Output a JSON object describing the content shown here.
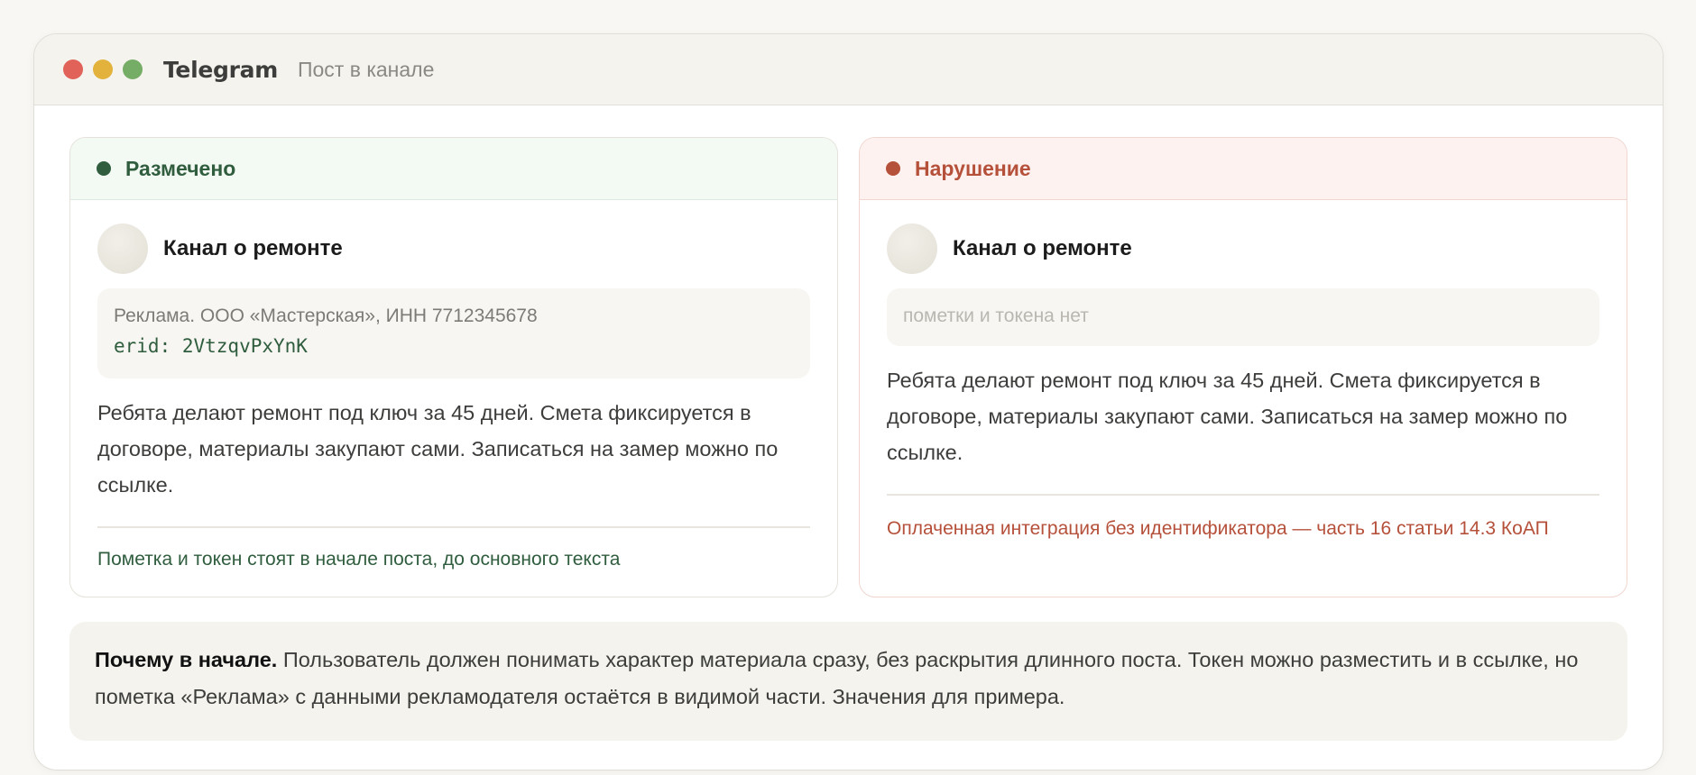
{
  "window": {
    "app_title": "Telegram",
    "subtitle": "Пост в канале"
  },
  "panels": [
    {
      "status": "Размечено",
      "status_color": "#2f5d3e",
      "channel_name": "Канал о ремонте",
      "ad_label": "Реклама. ООО «Мастерская», ИНН 7712345678",
      "erid": "erid: 2VtzqvPxYnK",
      "post_text": "Ребята делают ремонт под ключ за 45 дней. Смета фиксируется в договоре, материалы закупают сами. Записаться на замер можно по ссылке.",
      "note": "Пометка и токен стоят в начале поста, до основного текста"
    },
    {
      "status": "Нарушение",
      "status_color": "#b5503a",
      "channel_name": "Канал о ремонте",
      "empty_label": "пометки и токена нет",
      "post_text": "Ребята делают ремонт под ключ за 45 дней. Смета фиксируется в договоре, материалы закупают сами. Записаться на замер можно по ссылке.",
      "note": "Оплаченная интеграция без идентификатора — часть 16 статьи 14.3 КоАП"
    }
  ],
  "explanation": {
    "lead": "Почему в начале.",
    "text": " Пользователь должен понимать характер материала сразу, без раскрытия длинного поста. Токен можно разместить и в ссылке, но пометка «Реклама» с данными рекламодателя остаётся в видимой части. Значения для примера."
  }
}
